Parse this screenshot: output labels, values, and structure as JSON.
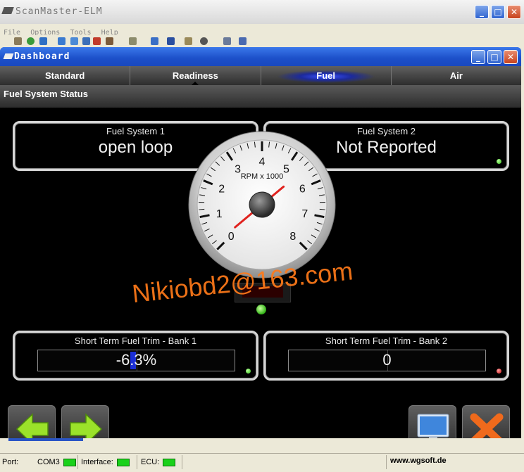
{
  "app": {
    "title": "ScanMaster-ELM",
    "menu": [
      "File",
      "Options",
      "Tools",
      "Help"
    ]
  },
  "window_buttons": {
    "minimize": "_",
    "maximize": "□",
    "close": "✕"
  },
  "dashboard": {
    "title": "Dashboard",
    "tabs": [
      {
        "label": "Standard"
      },
      {
        "label": "Readiness"
      },
      {
        "label": "Fuel",
        "active": true
      },
      {
        "label": "Air"
      }
    ],
    "section_title": "Fuel System Status",
    "fuel_system_1": {
      "label": "Fuel System 1",
      "value": "open loop",
      "indicator": "green"
    },
    "fuel_system_2": {
      "label": "Fuel System 2",
      "value": "Not Reported",
      "indicator": "green"
    },
    "gauge": {
      "label": "RPM x 1000",
      "ticks": [
        "0",
        "1",
        "2",
        "3",
        "4",
        "5",
        "6",
        "7",
        "8"
      ],
      "needle_value": 0
    },
    "stft_bank1": {
      "label": "Short Term Fuel Trim - Bank 1",
      "value": "-6.3%",
      "percent": -6.3,
      "indicator": "green"
    },
    "stft_bank2": {
      "label": "Short Term Fuel Trim - Bank 2",
      "value": "0",
      "percent": 0,
      "indicator": "red"
    },
    "nav": {
      "back_icon": "arrow-left-icon",
      "forward_icon": "arrow-right-icon",
      "monitor_icon": "monitor-icon",
      "close_icon": "close-x-icon"
    }
  },
  "watermark": "Nikiobd2@163.com",
  "status_bar": {
    "port_label": "Port:",
    "port_value": "COM3",
    "interface_label": "Interface:",
    "ecu_label": "ECU:",
    "url": "www.wgsoft.de"
  },
  "colors": {
    "accent": "#1c4fc9",
    "panel_border": "#d6d6d6",
    "led_on": "#1ad11a",
    "watermark": "#ff7a1a"
  }
}
